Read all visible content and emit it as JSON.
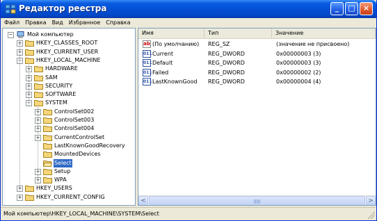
{
  "window": {
    "title": "Редактор реестра",
    "icon": "registry-editor-icon",
    "controls": {
      "minimize": "_",
      "maximize": "□",
      "close": "×"
    }
  },
  "menu": [
    "Файл",
    "Правка",
    "Вид",
    "Избранное",
    "Справка"
  ],
  "tree": [
    {
      "label": "Мой компьютер",
      "depth": 0,
      "expander": "−",
      "icon": "computer-icon"
    },
    {
      "label": "HKEY_CLASSES_ROOT",
      "depth": 1,
      "expander": "+",
      "icon": "folder-icon"
    },
    {
      "label": "HKEY_CURRENT_USER",
      "depth": 1,
      "expander": "+",
      "icon": "folder-icon"
    },
    {
      "label": "HKEY_LOCAL_MACHINE",
      "depth": 1,
      "expander": "−",
      "icon": "folder-icon"
    },
    {
      "label": "HARDWARE",
      "depth": 2,
      "expander": "+",
      "icon": "folder-icon"
    },
    {
      "label": "SAM",
      "depth": 2,
      "expander": "+",
      "icon": "folder-icon"
    },
    {
      "label": "SECURITY",
      "depth": 2,
      "expander": "+",
      "icon": "folder-icon"
    },
    {
      "label": "SOFTWARE",
      "depth": 2,
      "expander": "+",
      "icon": "folder-icon"
    },
    {
      "label": "SYSTEM",
      "depth": 2,
      "expander": "−",
      "icon": "folder-icon"
    },
    {
      "label": "ControlSet002",
      "depth": 3,
      "expander": "+",
      "icon": "folder-icon"
    },
    {
      "label": "ControlSet003",
      "depth": 3,
      "expander": "+",
      "icon": "folder-icon"
    },
    {
      "label": "ControlSet004",
      "depth": 3,
      "expander": "+",
      "icon": "folder-icon"
    },
    {
      "label": "CurrentControlSet",
      "depth": 3,
      "expander": "+",
      "icon": "folder-icon"
    },
    {
      "label": "LastKnownGoodRecovery",
      "depth": 3,
      "expander": "",
      "icon": "folder-icon"
    },
    {
      "label": "MountedDevices",
      "depth": 3,
      "expander": "",
      "icon": "folder-icon"
    },
    {
      "label": "Select",
      "depth": 3,
      "expander": "",
      "icon": "open-folder-icon",
      "selected": true
    },
    {
      "label": "Setup",
      "depth": 3,
      "expander": "+",
      "icon": "folder-icon"
    },
    {
      "label": "WPA",
      "depth": 3,
      "expander": "+",
      "icon": "folder-icon"
    },
    {
      "label": "HKEY_USERS",
      "depth": 1,
      "expander": "+",
      "icon": "folder-icon"
    },
    {
      "label": "HKEY_CURRENT_CONFIG",
      "depth": 1,
      "expander": "+",
      "icon": "folder-icon"
    }
  ],
  "list": {
    "columns": [
      "Имя",
      "Тип",
      "Значение"
    ],
    "rows": [
      {
        "icon": "string-value-icon",
        "icon_glyph": "ab",
        "name": "(По умолчанию)",
        "type": "REG_SZ",
        "value": "(значение не присвоено)"
      },
      {
        "icon": "binary-value-icon",
        "icon_glyph": "011",
        "name": "Current",
        "type": "REG_DWORD",
        "value": "0x00000003 (3)"
      },
      {
        "icon": "binary-value-icon",
        "icon_glyph": "011",
        "name": "Default",
        "type": "REG_DWORD",
        "value": "0x00000003 (3)"
      },
      {
        "icon": "binary-value-icon",
        "icon_glyph": "011",
        "name": "Failed",
        "type": "REG_DWORD",
        "value": "0x00000002 (2)"
      },
      {
        "icon": "binary-value-icon",
        "icon_glyph": "011",
        "name": "LastKnownGood",
        "type": "REG_DWORD",
        "value": "0x00000004 (4)"
      }
    ]
  },
  "scrollbar": {
    "left_arrow": "<",
    "right_arrow": ">"
  },
  "status": {
    "path": "Мой компьютер\\HKEY_LOCAL_MACHINE\\SYSTEM\\Select"
  },
  "colors": {
    "titlebar": "#0550d6",
    "selection": "#316ac5",
    "folder": "#f5d67a",
    "frame": "#ece9d8"
  }
}
